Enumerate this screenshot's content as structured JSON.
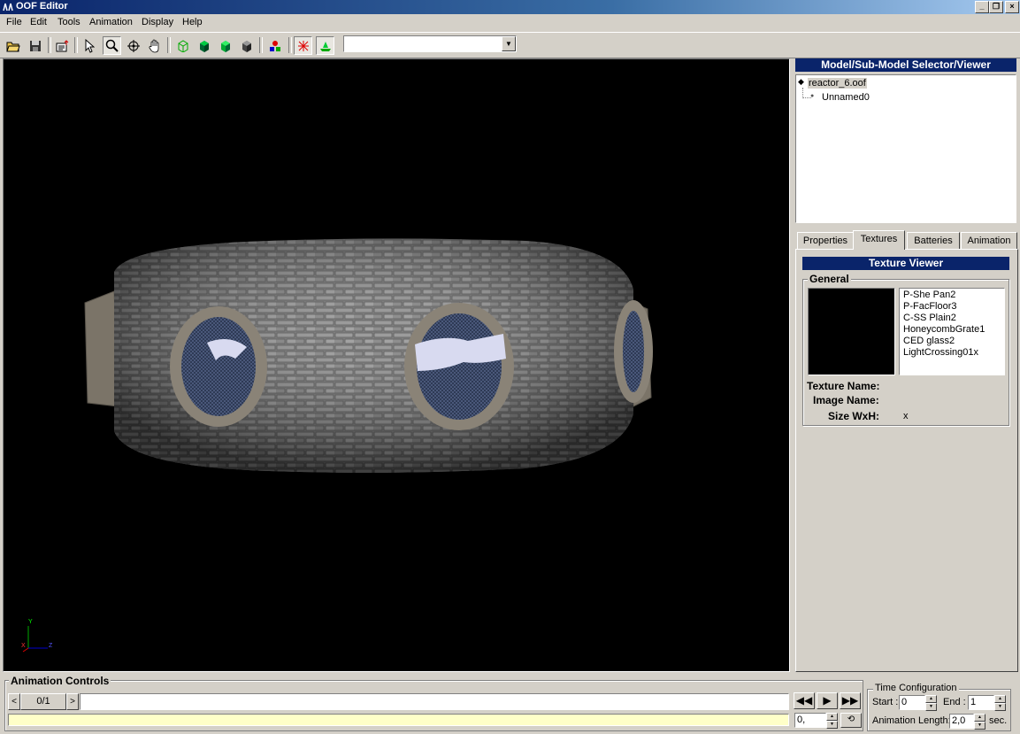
{
  "window": {
    "title": "OOF Editor"
  },
  "menu": [
    "File",
    "Edit",
    "Tools",
    "Animation",
    "Display",
    "Help"
  ],
  "toolbar": {
    "icons": [
      "open-folder-icon",
      "save-icon",
      "export-icon",
      "select-arrow-icon",
      "zoom-icon",
      "rotate-icon",
      "pan-hand-icon",
      "wireframe-cube-icon",
      "solid-cube-icon",
      "textured-cube-icon",
      "lit-cube-icon",
      "colors-icon",
      "axis-icon",
      "stand-icon"
    ],
    "combo_value": ""
  },
  "viewport": {
    "axis_labels": {
      "y": "Y",
      "x": "X",
      "z": "Z"
    }
  },
  "selector": {
    "title": "Model/Sub-Model Selector/Viewer",
    "root": "reactor_6.oof",
    "child": "Unnamed0"
  },
  "tabs": [
    "Properties",
    "Textures",
    "Batteries",
    "Animation"
  ],
  "active_tab": "Textures",
  "texture_viewer": {
    "title": "Texture Viewer",
    "group_label": "General",
    "textures": [
      "P-She Pan2",
      "P-FacFloor3",
      "C-SS Plain2",
      "HoneycombGrate1",
      "CED glass2",
      "LightCrossing01x"
    ],
    "texture_name_label": "Texture Name:",
    "image_name_label": "Image Name:",
    "size_label": "Size WxH:",
    "size_value": "x"
  },
  "animation_controls": {
    "title": "Animation Controls",
    "frame_counter": "0/1",
    "prev_label": "<",
    "next_label": ">",
    "time_value": "0,"
  },
  "time_config": {
    "title": "Time Configuration",
    "start_label": "Start :",
    "start_value": "0",
    "end_label": "End :",
    "end_value": "1",
    "length_label": "Animation Length:",
    "length_value": "2,0",
    "length_unit": "sec."
  },
  "colors": {
    "title_bar": "#0a246a",
    "viewport_bg": "#000000",
    "face": "#d4d0c8",
    "slider_track": "#ffffc8"
  }
}
